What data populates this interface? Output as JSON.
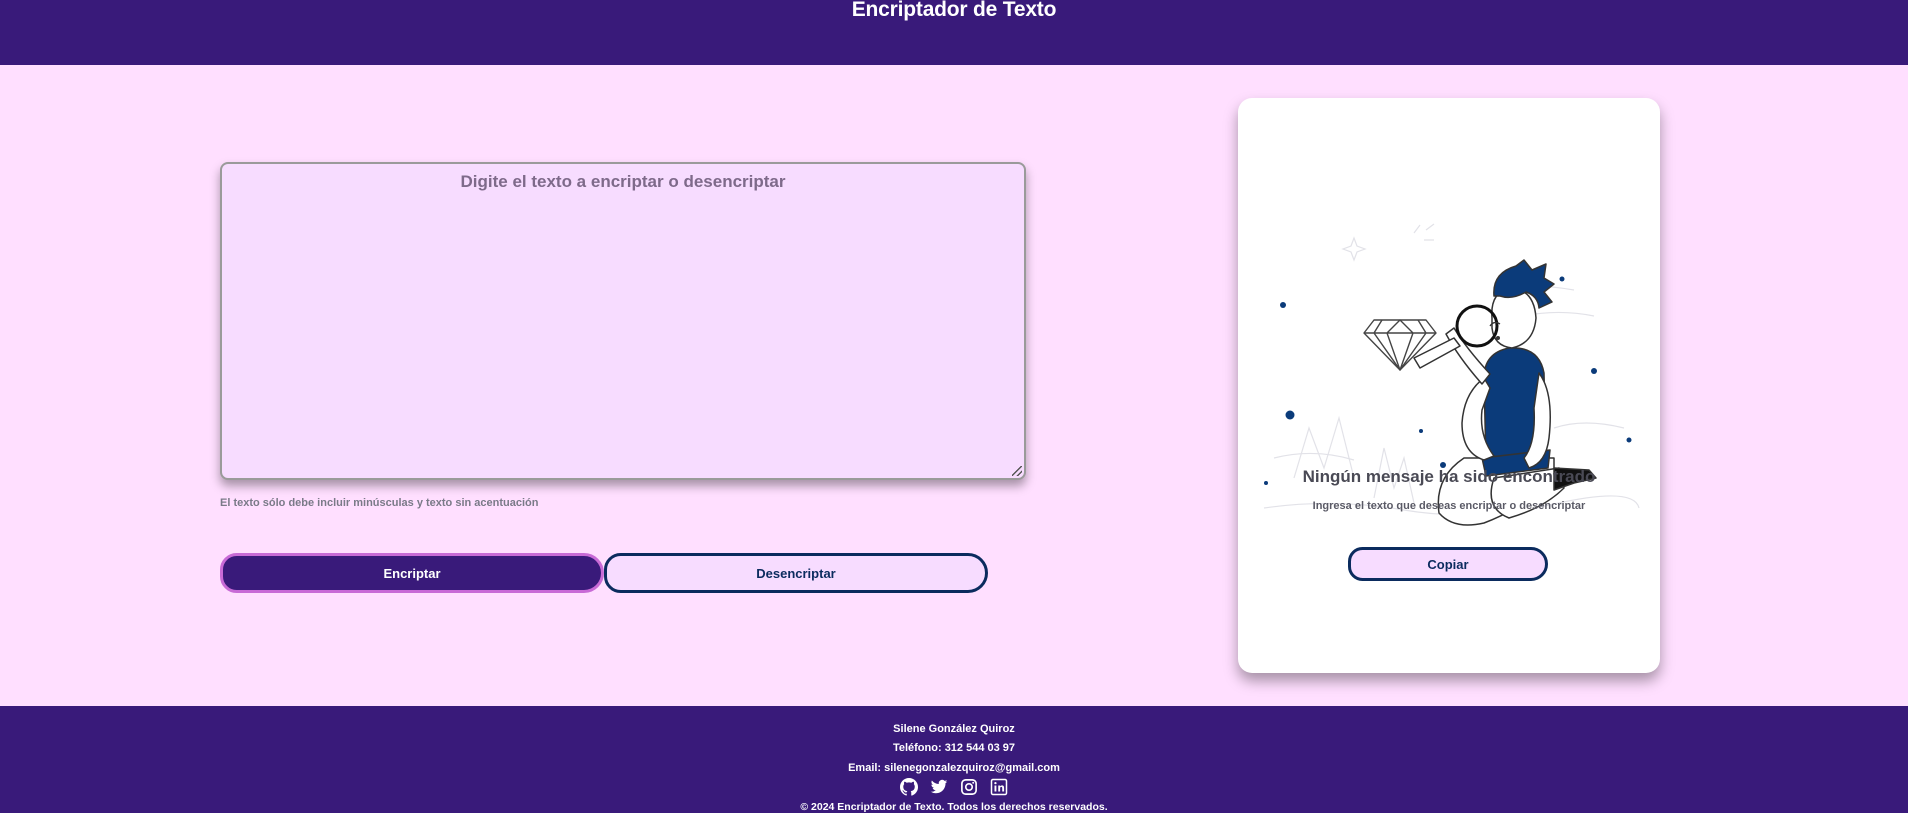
{
  "header": {
    "title": "Encriptador de Texto"
  },
  "input": {
    "placeholder": "Digite el texto a encriptar o desencriptar",
    "hint": "El texto sólo debe incluir minúsculas y texto sin acentuación"
  },
  "buttons": {
    "encrypt": "Encriptar",
    "decrypt": "Desencriptar"
  },
  "output": {
    "title": "Ningún mensaje ha sido encontrado",
    "subtitle": "Ingresa el texto que deseas encriptar o desencriptar",
    "copy": "Copiar"
  },
  "footer": {
    "name": "Silene González Quiroz",
    "phone": "Teléfono: 312 544 03 97",
    "email": "Email: silenegonzalezquiroz@gmail.com",
    "copyright": "© 2024 Encriptador de Texto. Todos los derechos reservados.",
    "socials": [
      "github-icon",
      "twitter-icon",
      "instagram-icon",
      "linkedin-icon"
    ]
  },
  "colors": {
    "background": "#ffdfff",
    "header": "#391a7a",
    "accent": "#0b2b5e",
    "input_bg": "#f7dcff",
    "encrypt_border": "#c86ad6"
  }
}
